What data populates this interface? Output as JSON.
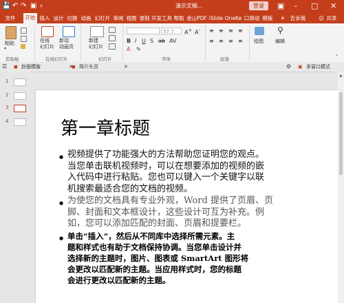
{
  "app": {
    "title": "演示文稿...",
    "login": "登录",
    "tell_me": "告诉我",
    "share": "共享"
  },
  "tabs": [
    "文件",
    "开始",
    "插入",
    "设计",
    "切换",
    "动画",
    "幻灯片",
    "审阅",
    "视图",
    "录制",
    "开发工具",
    "帮助",
    "金山PDF",
    "iSlide",
    "OneKe",
    "口袋动",
    "模板"
  ],
  "ribbon": {
    "paste": "粘贴",
    "clipboard": "剪贴板",
    "online_slides": "在线\n幻灯片",
    "new_animation": "新动\n动画页",
    "online_slides_group": "在线幻灯片",
    "new_slide": "新建\n幻灯片",
    "slides_group": "幻灯片",
    "font_size": "57.7",
    "font_group": "字体",
    "paragraph_group": "段落",
    "drawing": "绘图",
    "editing": "编辑"
  },
  "doc_tabs": {
    "tab1": "封面模版",
    "tab2": "简介头页",
    "multi_window": "多窗口模式"
  },
  "slides": [
    {
      "num": "1"
    },
    {
      "num": "2"
    },
    {
      "num": "3"
    },
    {
      "num": "4"
    }
  ],
  "slide": {
    "title": "第一章标题",
    "paragraphs": [
      [
        "视频提供了功能强大的方法帮助您证明您的观点。",
        "当您单击联机视频时，可以在想要添加的视频的嵌",
        "入代码中进行粘贴。您也可以键入一个关键字以联",
        "机搜索最适合您的文档的视频。"
      ],
      [
        "为使您的文档具有专业外观，Word 提供了页眉、页",
        "脚、封面和文本框设计，这些设计可互为补充。例",
        "如，您可以添加匹配的封面、页眉和提要栏。"
      ],
      [
        "单击“插入”，然后从不同库中选择所需元素。主",
        "题和样式也有助于文档保持协调。当您单击设计并",
        "选择新的主题时，图片、图表或 SmartArt 图形将",
        "会更改以匹配新的主题。当应用样式时，您的标题",
        "会进行更改以匹配新的主题。"
      ]
    ]
  },
  "colors": {
    "accent": "#c43e1c",
    "ribbon_bg": "#f3f3f3"
  }
}
